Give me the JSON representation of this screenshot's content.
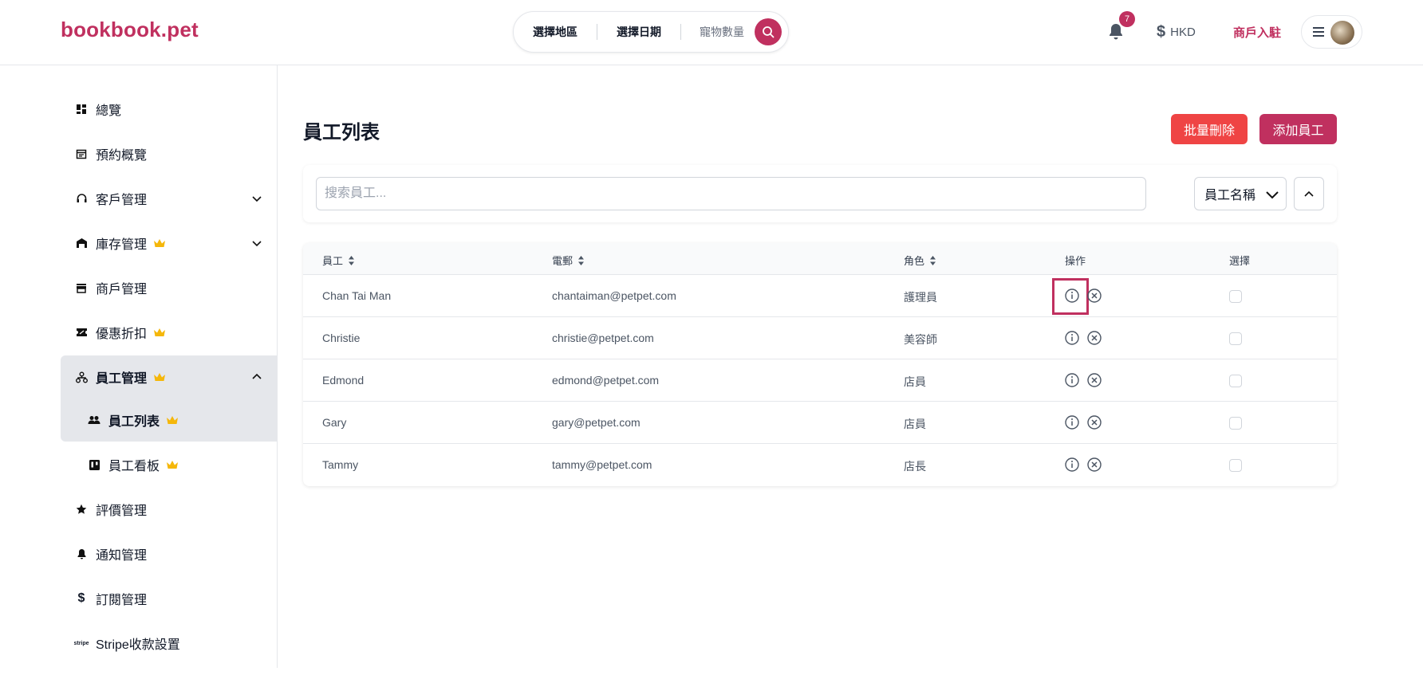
{
  "header": {
    "logo": "bookbook.pet",
    "search": {
      "region": "選擇地區",
      "date": "選擇日期",
      "pets": "寵物數量"
    },
    "notification_count": "7",
    "currency": "HKD",
    "merchant_link": "商戶入駐"
  },
  "sidebar": {
    "items": [
      {
        "label": "總覽",
        "icon": "dashboard-icon"
      },
      {
        "label": "預約概覽",
        "icon": "calendar-icon"
      },
      {
        "label": "客戶管理",
        "icon": "headset-icon"
      },
      {
        "label": "庫存管理",
        "icon": "warehouse-icon"
      },
      {
        "label": "商戶管理",
        "icon": "store-icon"
      },
      {
        "label": "優惠折扣",
        "icon": "ticket-icon"
      },
      {
        "label": "員工管理",
        "icon": "org-chart-icon"
      },
      {
        "label": "員工列表",
        "icon": "people-icon"
      },
      {
        "label": "員工看板",
        "icon": "kanban-icon"
      },
      {
        "label": "評價管理",
        "icon": "star-icon"
      },
      {
        "label": "通知管理",
        "icon": "bell-icon"
      },
      {
        "label": "訂閱管理",
        "icon": "dollar-icon"
      },
      {
        "label": "Stripe收款設置",
        "icon": "stripe-icon"
      }
    ]
  },
  "main": {
    "title": "員工列表",
    "bulk_delete": "批量刪除",
    "add_staff": "添加員工",
    "search_placeholder": "搜索員工...",
    "sort_field": "員工名稱",
    "table": {
      "headers": {
        "staff": "員工",
        "email": "電郵",
        "role": "角色",
        "actions": "操作",
        "select": "選擇"
      },
      "rows": [
        {
          "name": "Chan Tai Man",
          "email": "chantaiman@petpet.com",
          "role": "護理員"
        },
        {
          "name": "Christie",
          "email": "christie@petpet.com",
          "role": "美容師"
        },
        {
          "name": "Edmond",
          "email": "edmond@petpet.com",
          "role": "店員"
        },
        {
          "name": "Gary",
          "email": "gary@petpet.com",
          "role": "店員"
        },
        {
          "name": "Tammy",
          "email": "tammy@petpet.com",
          "role": "店長"
        }
      ]
    }
  },
  "colors": {
    "brand": "#c0305f",
    "danger": "#ef4444",
    "crown": "#f5b70a"
  }
}
